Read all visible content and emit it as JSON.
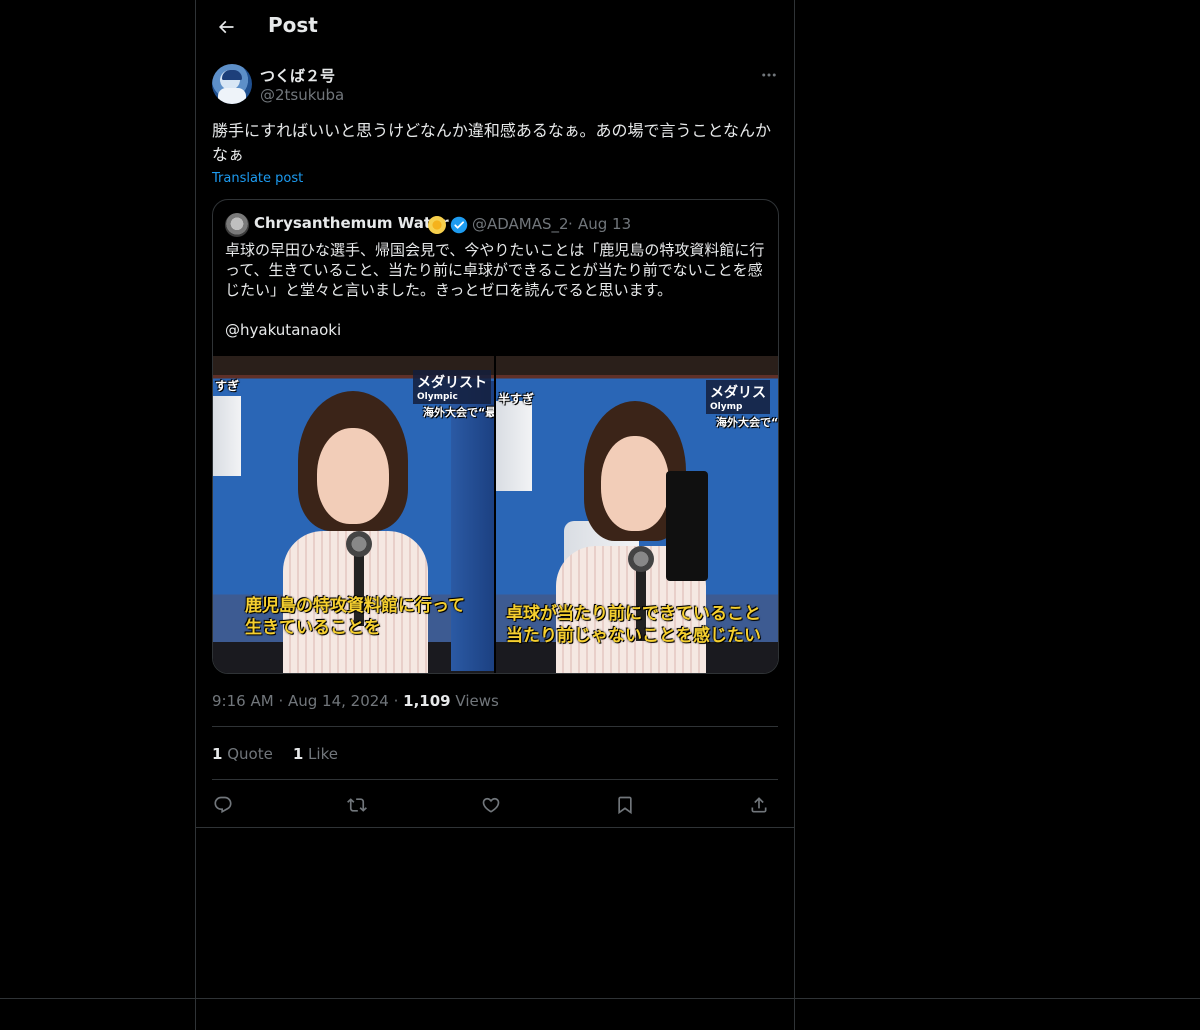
{
  "header": {
    "title": "Post"
  },
  "post": {
    "author_name": "つくば２号",
    "author_handle": "@2tsukuba",
    "text": "勝手にすればいいと思うけどなんか違和感あるなぁ。あの場で言うことなんかなぁ",
    "translate_label": "Translate post",
    "time": "9:16 AM",
    "date": "Aug 14, 2024",
    "views_count": "1,109",
    "views_label": "Views",
    "quote_count": "1",
    "quote_label": "Quote",
    "like_count": "1",
    "like_label": "Like"
  },
  "quote": {
    "name": "Chrysanthemum Water",
    "handle": "@ADAMAS_2",
    "date": "Aug 13",
    "text": "卓球の早田ひな選手、帰国会見で、今やりたいことは「鹿児島の特攻資料館に行って、生きていること、当たり前に卓球ができることが当たり前でないことを感じたい」と堂々と言いました。きっとゼロを読んでると思います。\n\n@hyakutanaoki",
    "images": {
      "left": {
        "caption_line1": "鹿児島の特攻資料館に行って",
        "caption_line2": "生きていることを",
        "tv_logo": "メダリスト",
        "tv_logo_sub": "Olympic",
        "tv_ticker": "海外大会で“最",
        "corner_text": "すぎ"
      },
      "right": {
        "caption_line1": "卓球が当たり前にできていること",
        "caption_line2": "当たり前じゃないことを感じたい",
        "tv_logo": "メダリス",
        "tv_logo_sub": "Olymp",
        "tv_ticker": "海外大会で“",
        "corner_text": "半すぎ"
      }
    }
  },
  "colors": {
    "background": "#000000",
    "border": "#2f3336",
    "text_primary": "#e7e9ea",
    "text_secondary": "#71767b",
    "link": "#1d9bf0",
    "caption": "#f5cf2f"
  },
  "icons": {
    "back": "arrow-left-icon",
    "more": "more-horizontal-icon",
    "verified": "verified-badge-icon",
    "reply": "reply-icon",
    "repost": "repost-icon",
    "like": "heart-icon",
    "bookmark": "bookmark-icon",
    "share": "share-icon"
  }
}
